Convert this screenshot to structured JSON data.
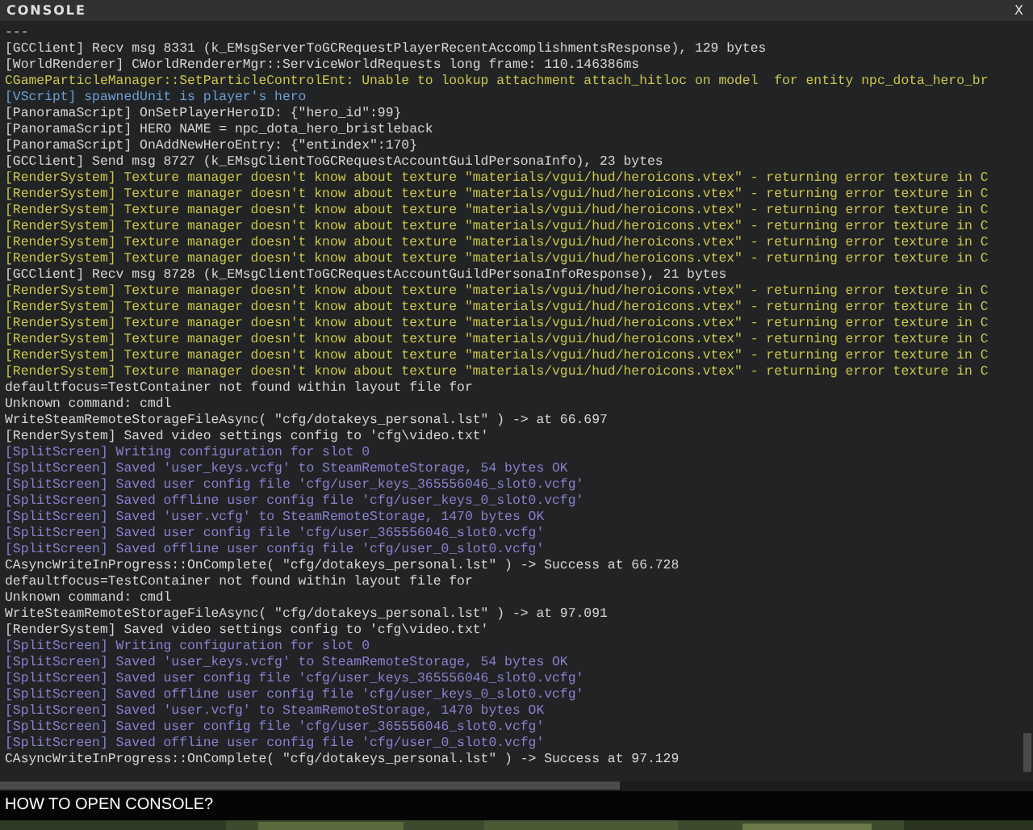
{
  "window": {
    "title": "CONSOLE",
    "close": "X"
  },
  "log": [
    {
      "kind": "info",
      "text": "---"
    },
    {
      "kind": "info",
      "text": "[GCClient] Recv msg 8331 (k_EMsgServerToGCRequestPlayerRecentAccomplishmentsResponse), 129 bytes"
    },
    {
      "kind": "info",
      "text": "[WorldRenderer] CWorldRendererMgr::ServiceWorldRequests long frame: 110.146386ms"
    },
    {
      "kind": "warning",
      "text": "CGameParticleManager::SetParticleControlEnt: Unable to lookup attachment attach_hitloc on model  for entity npc_dota_hero_br"
    },
    {
      "kind": "script",
      "text": "[VScript] spawnedUnit is player's hero"
    },
    {
      "kind": "info",
      "text": "[PanoramaScript] OnSetPlayerHeroID: {\"hero_id\":99}"
    },
    {
      "kind": "info",
      "text": "[PanoramaScript] HERO NAME = npc_dota_hero_bristleback"
    },
    {
      "kind": "info",
      "text": "[PanoramaScript] OnAddNewHeroEntry: {\"entindex\":170}"
    },
    {
      "kind": "info",
      "text": "[GCClient] Send msg 8727 (k_EMsgClientToGCRequestAccountGuildPersonaInfo), 23 bytes"
    },
    {
      "kind": "warning",
      "text": "[RenderSystem] Texture manager doesn't know about texture \"materials/vgui/hud/heroicons.vtex\" - returning error texture in C"
    },
    {
      "kind": "warning",
      "text": "[RenderSystem] Texture manager doesn't know about texture \"materials/vgui/hud/heroicons.vtex\" - returning error texture in C"
    },
    {
      "kind": "warning",
      "text": "[RenderSystem] Texture manager doesn't know about texture \"materials/vgui/hud/heroicons.vtex\" - returning error texture in C"
    },
    {
      "kind": "warning",
      "text": "[RenderSystem] Texture manager doesn't know about texture \"materials/vgui/hud/heroicons.vtex\" - returning error texture in C"
    },
    {
      "kind": "warning",
      "text": "[RenderSystem] Texture manager doesn't know about texture \"materials/vgui/hud/heroicons.vtex\" - returning error texture in C"
    },
    {
      "kind": "warning",
      "text": "[RenderSystem] Texture manager doesn't know about texture \"materials/vgui/hud/heroicons.vtex\" - returning error texture in C"
    },
    {
      "kind": "info",
      "text": "[GCClient] Recv msg 8728 (k_EMsgClientToGCRequestAccountGuildPersonaInfoResponse), 21 bytes"
    },
    {
      "kind": "warning",
      "text": "[RenderSystem] Texture manager doesn't know about texture \"materials/vgui/hud/heroicons.vtex\" - returning error texture in C"
    },
    {
      "kind": "warning",
      "text": "[RenderSystem] Texture manager doesn't know about texture \"materials/vgui/hud/heroicons.vtex\" - returning error texture in C"
    },
    {
      "kind": "warning",
      "text": "[RenderSystem] Texture manager doesn't know about texture \"materials/vgui/hud/heroicons.vtex\" - returning error texture in C"
    },
    {
      "kind": "warning",
      "text": "[RenderSystem] Texture manager doesn't know about texture \"materials/vgui/hud/heroicons.vtex\" - returning error texture in C"
    },
    {
      "kind": "warning",
      "text": "[RenderSystem] Texture manager doesn't know about texture \"materials/vgui/hud/heroicons.vtex\" - returning error texture in C"
    },
    {
      "kind": "warning",
      "text": "[RenderSystem] Texture manager doesn't know about texture \"materials/vgui/hud/heroicons.vtex\" - returning error texture in C"
    },
    {
      "kind": "info",
      "text": "defaultfocus=TestContainer not found within layout file for"
    },
    {
      "kind": "info",
      "text": "Unknown command: cmdl"
    },
    {
      "kind": "info",
      "text": "WriteSteamRemoteStorageFileAsync( \"cfg/dotakeys_personal.lst\" ) -> at 66.697"
    },
    {
      "kind": "info",
      "text": "[RenderSystem] Saved video settings config to 'cfg\\video.txt'"
    },
    {
      "kind": "split",
      "text": "[SplitScreen] Writing configuration for slot 0"
    },
    {
      "kind": "split",
      "text": "[SplitScreen] Saved 'user_keys.vcfg' to SteamRemoteStorage, 54 bytes OK"
    },
    {
      "kind": "split",
      "text": "[SplitScreen] Saved user config file 'cfg/user_keys_365556046_slot0.vcfg'"
    },
    {
      "kind": "split",
      "text": "[SplitScreen] Saved offline user config file 'cfg/user_keys_0_slot0.vcfg'"
    },
    {
      "kind": "split",
      "text": "[SplitScreen] Saved 'user.vcfg' to SteamRemoteStorage, 1470 bytes OK"
    },
    {
      "kind": "split",
      "text": "[SplitScreen] Saved user config file 'cfg/user_365556046_slot0.vcfg'"
    },
    {
      "kind": "split",
      "text": "[SplitScreen] Saved offline user config file 'cfg/user_0_slot0.vcfg'"
    },
    {
      "kind": "info",
      "text": "CAsyncWriteInProgress::OnComplete( \"cfg/dotakeys_personal.lst\" ) -> Success at 66.728"
    },
    {
      "kind": "info",
      "text": "defaultfocus=TestContainer not found within layout file for"
    },
    {
      "kind": "info",
      "text": "Unknown command: cmdl"
    },
    {
      "kind": "info",
      "text": "WriteSteamRemoteStorageFileAsync( \"cfg/dotakeys_personal.lst\" ) -> at 97.091"
    },
    {
      "kind": "info",
      "text": "[RenderSystem] Saved video settings config to 'cfg\\video.txt'"
    },
    {
      "kind": "split",
      "text": "[SplitScreen] Writing configuration for slot 0"
    },
    {
      "kind": "split",
      "text": "[SplitScreen] Saved 'user_keys.vcfg' to SteamRemoteStorage, 54 bytes OK"
    },
    {
      "kind": "split",
      "text": "[SplitScreen] Saved user config file 'cfg/user_keys_365556046_slot0.vcfg'"
    },
    {
      "kind": "split",
      "text": "[SplitScreen] Saved offline user config file 'cfg/user_keys_0_slot0.vcfg'"
    },
    {
      "kind": "split",
      "text": "[SplitScreen] Saved 'user.vcfg' to SteamRemoteStorage, 1470 bytes OK"
    },
    {
      "kind": "split",
      "text": "[SplitScreen] Saved user config file 'cfg/user_365556046_slot0.vcfg'"
    },
    {
      "kind": "split",
      "text": "[SplitScreen] Saved offline user config file 'cfg/user_0_slot0.vcfg'"
    },
    {
      "kind": "info",
      "text": "CAsyncWriteInProgress::OnComplete( \"cfg/dotakeys_personal.lst\" ) -> Success at 97.129"
    }
  ],
  "caption": "HOW TO OPEN CONSOLE?"
}
